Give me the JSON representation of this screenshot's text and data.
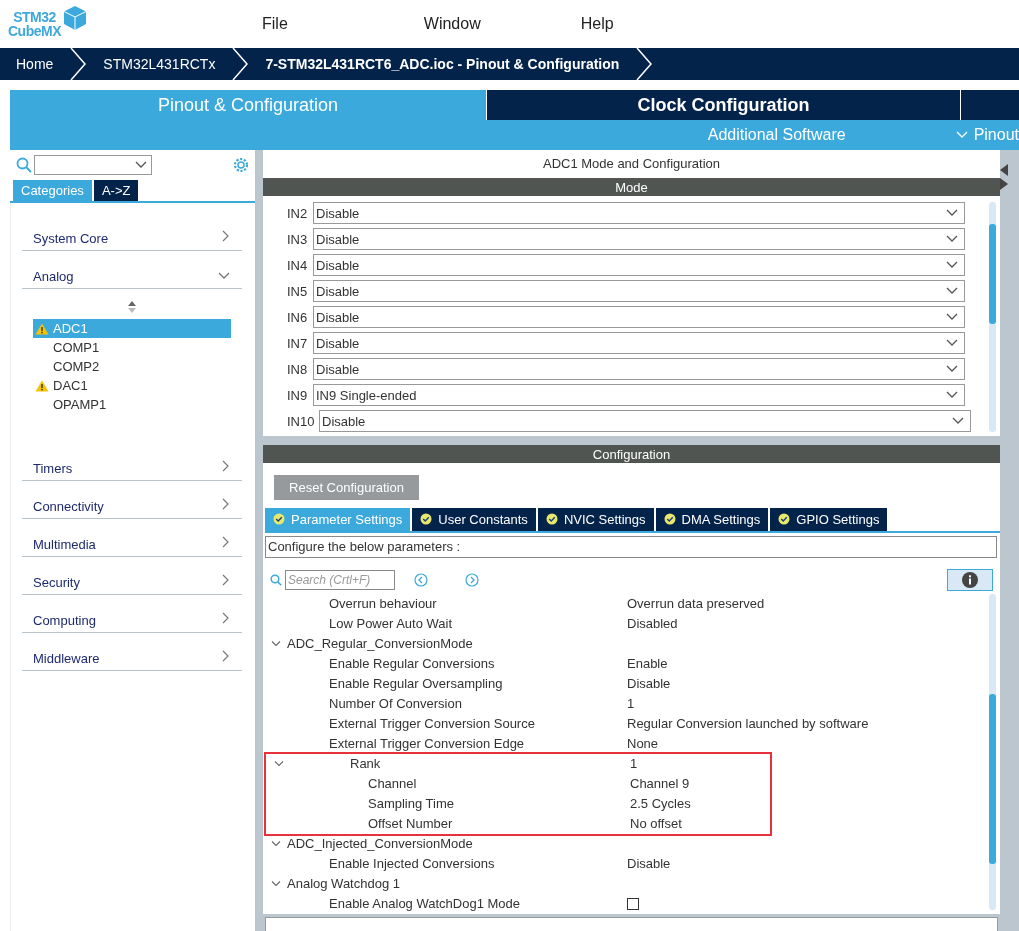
{
  "logo": {
    "line1": "STM32",
    "line2": "CubeMX"
  },
  "menu": [
    "File",
    "Window",
    "Help"
  ],
  "breadcrumb": [
    {
      "label": "Home",
      "current": false
    },
    {
      "label": "STM32L431RCTx",
      "current": false
    },
    {
      "label": "7-STM32L431RCT6_ADC.ioc - Pinout & Configuration",
      "current": true
    }
  ],
  "main_tabs": [
    {
      "label": "Pinout & Configuration",
      "selected": true
    },
    {
      "label": "Clock Configuration",
      "selected": false
    }
  ],
  "sub_tabs": [
    {
      "label": "Additional Software",
      "kind": "plain"
    },
    {
      "label": "Pinout",
      "kind": "dropdown"
    }
  ],
  "view_tabs": [
    {
      "label": "Categories",
      "selected": true
    },
    {
      "label": "A->Z",
      "selected": false
    }
  ],
  "categories": [
    {
      "label": "System Core",
      "expanded": false
    },
    {
      "label": "Analog",
      "expanded": true,
      "children": [
        {
          "label": "ADC1",
          "warning": true,
          "selected": true
        },
        {
          "label": "COMP1",
          "warning": false,
          "selected": false
        },
        {
          "label": "COMP2",
          "warning": false,
          "selected": false
        },
        {
          "label": "DAC1",
          "warning": true,
          "selected": false
        },
        {
          "label": "OPAMP1",
          "warning": false,
          "selected": false
        }
      ]
    },
    {
      "label": "Timers",
      "expanded": false
    },
    {
      "label": "Connectivity",
      "expanded": false
    },
    {
      "label": "Multimedia",
      "expanded": false
    },
    {
      "label": "Security",
      "expanded": false
    },
    {
      "label": "Computing",
      "expanded": false
    },
    {
      "label": "Middleware",
      "expanded": false
    }
  ],
  "panel": {
    "title": "ADC1 Mode and Configuration",
    "mode_header": "Mode",
    "mode_rows": [
      {
        "label": "IN2",
        "value": "Disable"
      },
      {
        "label": "IN3",
        "value": "Disable"
      },
      {
        "label": "IN4",
        "value": "Disable"
      },
      {
        "label": "IN5",
        "value": "Disable"
      },
      {
        "label": "IN6",
        "value": "Disable"
      },
      {
        "label": "IN7",
        "value": "Disable"
      },
      {
        "label": "IN8",
        "value": "Disable"
      },
      {
        "label": "IN9",
        "value": "IN9 Single-ended"
      },
      {
        "label": "IN10",
        "value": "Disable"
      }
    ],
    "config_header": "Configuration",
    "reset_button": "Reset Configuration",
    "config_tabs": [
      {
        "label": "Parameter Settings",
        "selected": true
      },
      {
        "label": "User Constants",
        "selected": false
      },
      {
        "label": "NVIC Settings",
        "selected": false
      },
      {
        "label": "DMA Settings",
        "selected": false
      },
      {
        "label": "GPIO Settings",
        "selected": false
      }
    ],
    "description": "Configure the below parameters :",
    "search": {
      "placeholder": "Search (Crtl+F)"
    },
    "parameters": [
      {
        "kind": "setting",
        "name": "Overrun behaviour",
        "value": "Overrun data preserved"
      },
      {
        "kind": "setting",
        "name": "Low Power Auto Wait",
        "value": "Disabled"
      },
      {
        "kind": "group",
        "name": "ADC_Regular_ConversionMode",
        "expanded": true,
        "highlighted": false,
        "children": [
          {
            "kind": "setting",
            "name": "Enable Regular Conversions",
            "value": "Enable"
          },
          {
            "kind": "setting",
            "name": "Enable Regular Oversampling",
            "value": "Disable"
          },
          {
            "kind": "setting",
            "name": "Number Of Conversion",
            "value": "1"
          },
          {
            "kind": "setting",
            "name": "External Trigger Conversion Source",
            "value": "Regular Conversion launched by software"
          },
          {
            "kind": "setting",
            "name": "External Trigger Conversion Edge",
            "value": "None"
          },
          {
            "kind": "group",
            "name": "Rank",
            "value": "1",
            "expanded": true,
            "highlighted": true,
            "children": [
              {
                "kind": "setting",
                "name": "Channel",
                "value": "Channel 9"
              },
              {
                "kind": "setting",
                "name": "Sampling Time",
                "value": "2.5 Cycles"
              },
              {
                "kind": "setting",
                "name": "Offset Number",
                "value": "No offset"
              }
            ]
          }
        ]
      },
      {
        "kind": "group",
        "name": "ADC_Injected_ConversionMode",
        "expanded": true,
        "highlighted": false,
        "children": [
          {
            "kind": "setting",
            "name": "Enable Injected Conversions",
            "value": "Disable"
          }
        ]
      },
      {
        "kind": "group",
        "name": "Analog Watchdog 1",
        "expanded": true,
        "highlighted": false,
        "children": [
          {
            "kind": "checkbox",
            "name": "Enable Analog WatchDog1 Mode",
            "checked": false
          }
        ]
      }
    ]
  }
}
